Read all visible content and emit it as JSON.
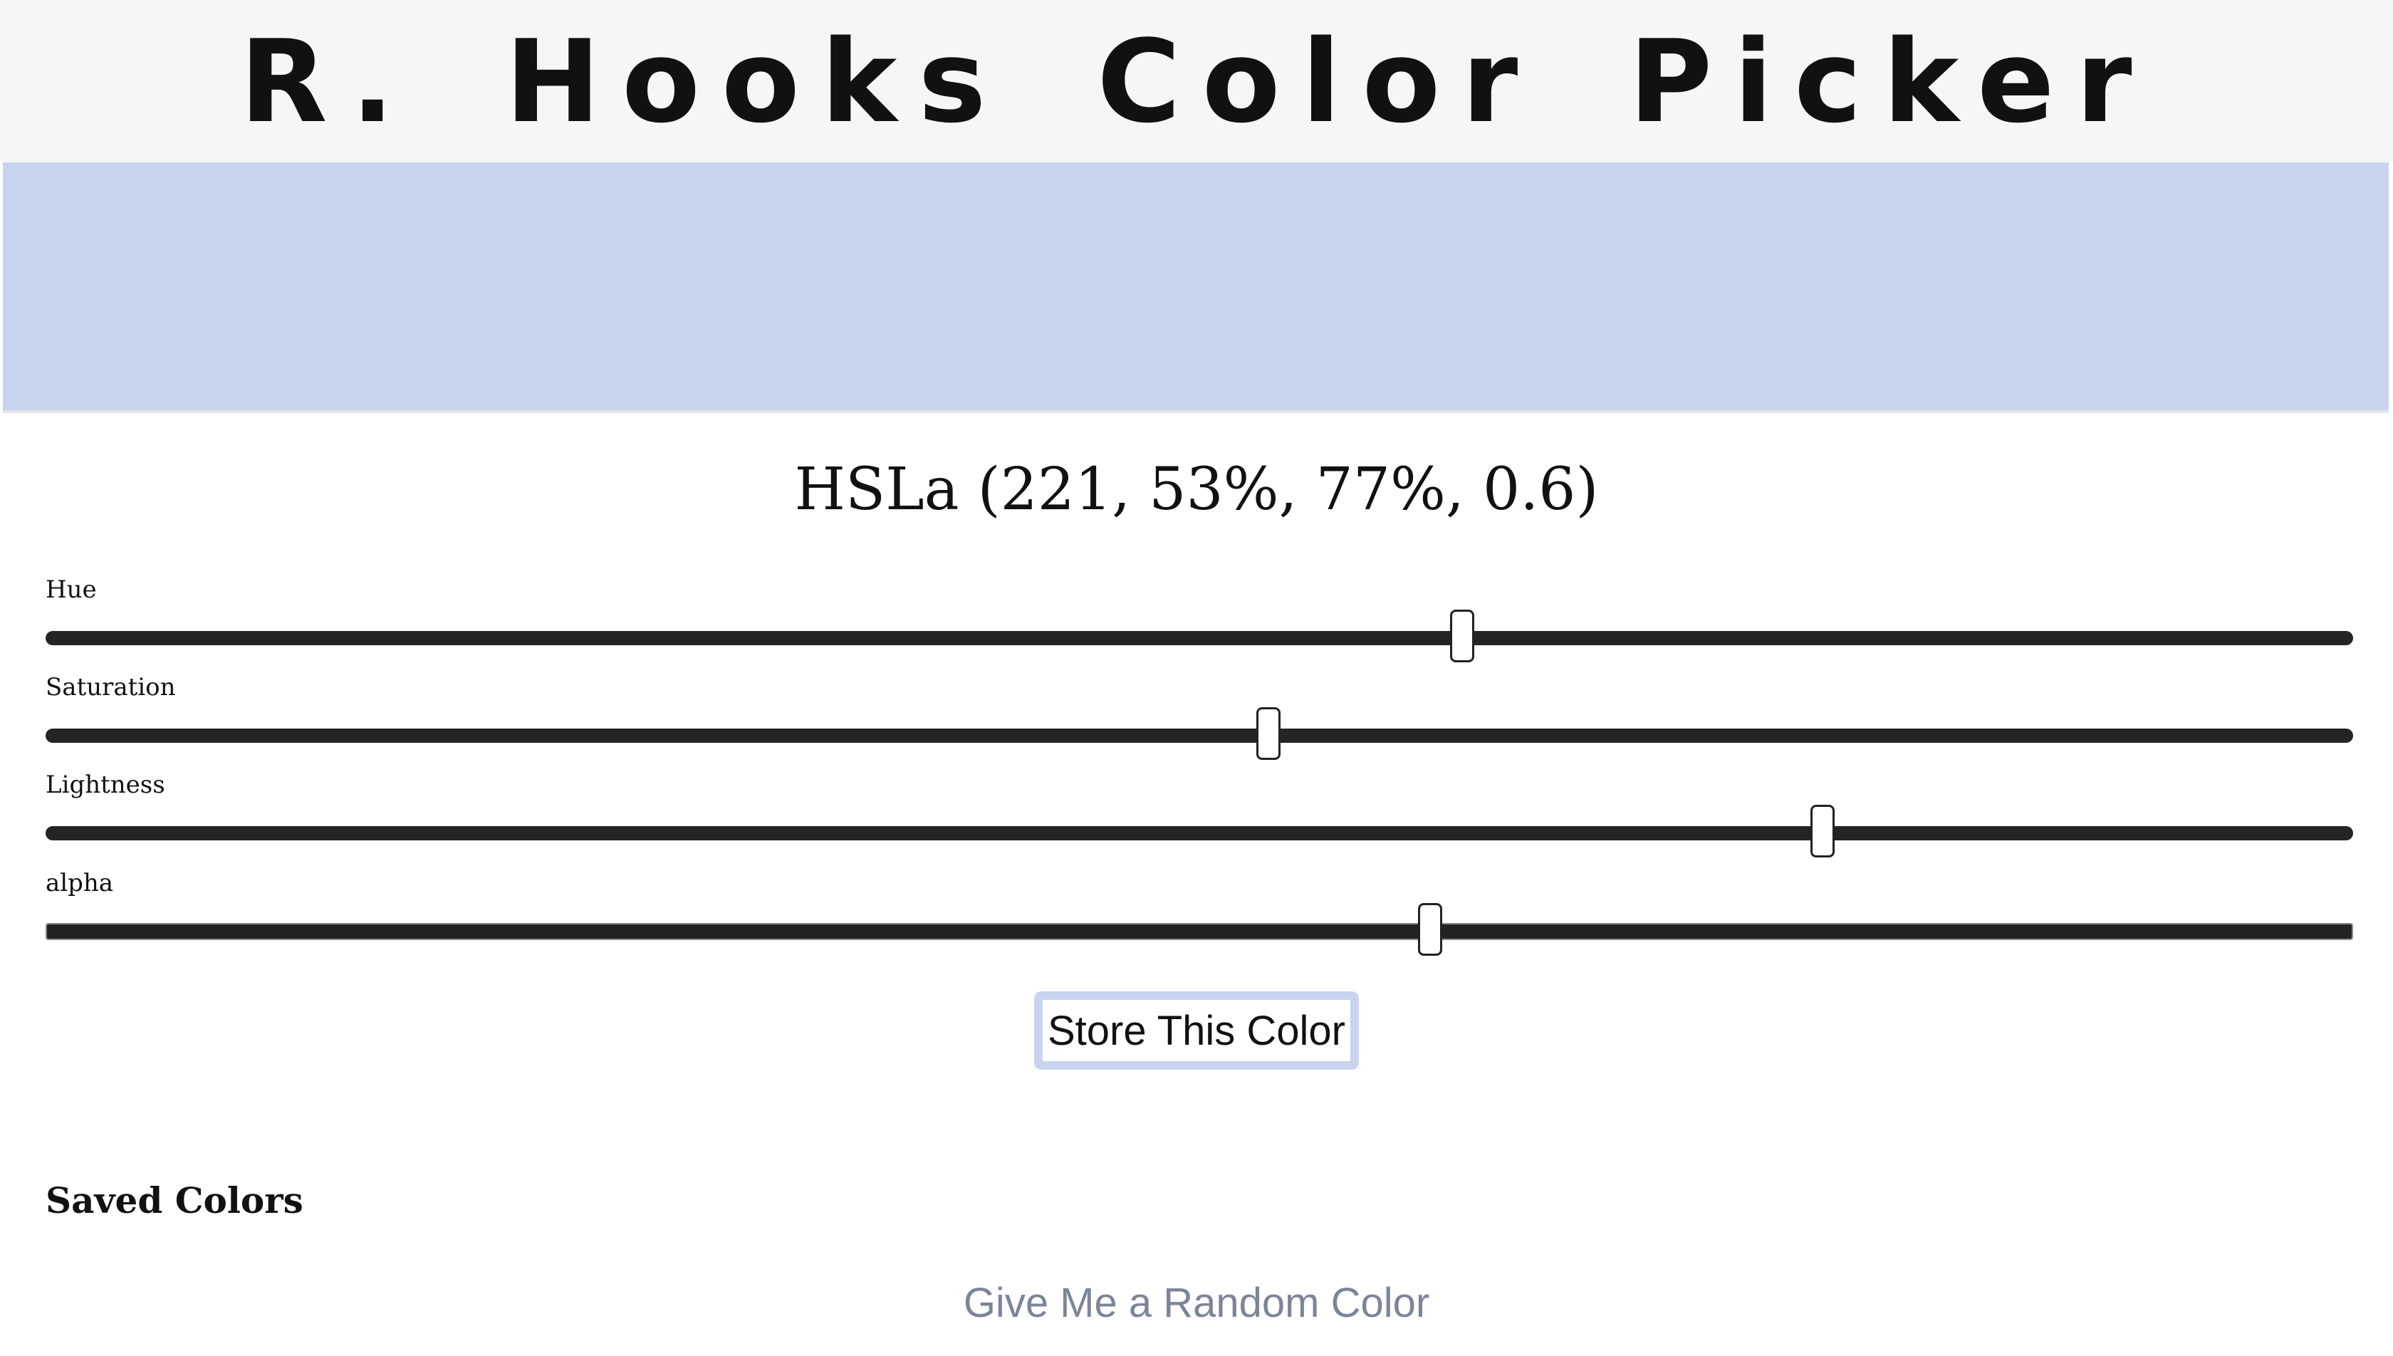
{
  "header": {
    "title": "R. Hooks Color Picker"
  },
  "preview": {
    "color": "#c9d4ef"
  },
  "readout": {
    "text": "HSLa (221, 53%, 77%, 0.6)"
  },
  "sliders": [
    {
      "label": "Hue",
      "value": 221,
      "min": 0,
      "max": 360
    },
    {
      "label": "Saturation",
      "value": 53,
      "min": 0,
      "max": 100
    },
    {
      "label": "Lightness",
      "value": 77,
      "min": 0,
      "max": 100
    },
    {
      "label": "alpha",
      "value": 0.6,
      "min": 0,
      "max": 1
    }
  ],
  "actions": {
    "store_label": "Store This Color",
    "random_label": "Give Me a Random Color"
  },
  "saved": {
    "heading": "Saved Colors"
  },
  "colors": {
    "header_bg": "#f6f6f4",
    "track": "#242424",
    "store_border": "#c8d3ef",
    "random_text": "#7c8598"
  }
}
